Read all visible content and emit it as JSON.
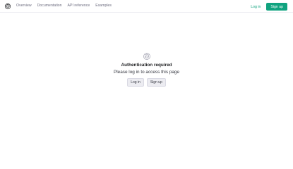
{
  "header": {
    "logo_icon": "openai-logo-icon",
    "nav": [
      "Overview",
      "Documentation",
      "API reference",
      "Examples"
    ],
    "login_label": "Log in",
    "signup_label": "Sign up"
  },
  "auth": {
    "icon": "openai-logo-icon",
    "title": "Authentication required",
    "subtitle": "Please log in to access this page",
    "login_label": "Log in",
    "signup_label": "Sign up"
  },
  "colors": {
    "accent": "#10a37f",
    "text": "#202123",
    "muted": "#6e6e80"
  }
}
